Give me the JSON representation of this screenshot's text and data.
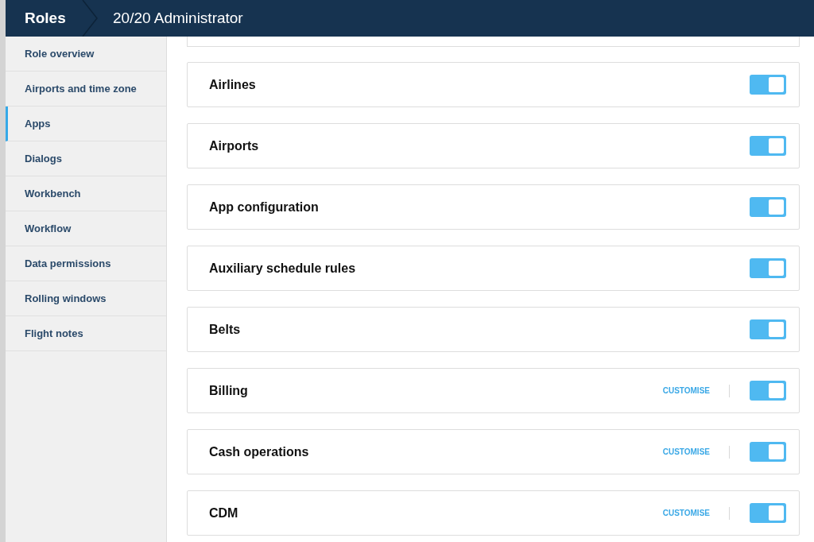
{
  "header": {
    "section": "Roles",
    "title": "20/20 Administrator"
  },
  "sidebar": {
    "items": [
      {
        "label": "Role overview",
        "selected": false
      },
      {
        "label": "Airports and time zone",
        "selected": false
      },
      {
        "label": "Apps",
        "selected": true
      },
      {
        "label": "Dialogs",
        "selected": false
      },
      {
        "label": "Workbench",
        "selected": false
      },
      {
        "label": "Workflow",
        "selected": false
      },
      {
        "label": "Data permissions",
        "selected": false
      },
      {
        "label": "Rolling windows",
        "selected": false
      },
      {
        "label": "Flight notes",
        "selected": false
      }
    ]
  },
  "apps": [
    {
      "name": "Airlines",
      "on": true
    },
    {
      "name": "Airports",
      "on": true
    },
    {
      "name": "App configuration",
      "on": true
    },
    {
      "name": "Auxiliary schedule rules",
      "on": true
    },
    {
      "name": "Belts",
      "on": true
    },
    {
      "name": "Billing",
      "on": true,
      "action": "CUSTOMISE"
    },
    {
      "name": "Cash operations",
      "on": true,
      "action": "CUSTOMISE"
    },
    {
      "name": "CDM",
      "on": true,
      "action": "CUSTOMISE"
    }
  ]
}
